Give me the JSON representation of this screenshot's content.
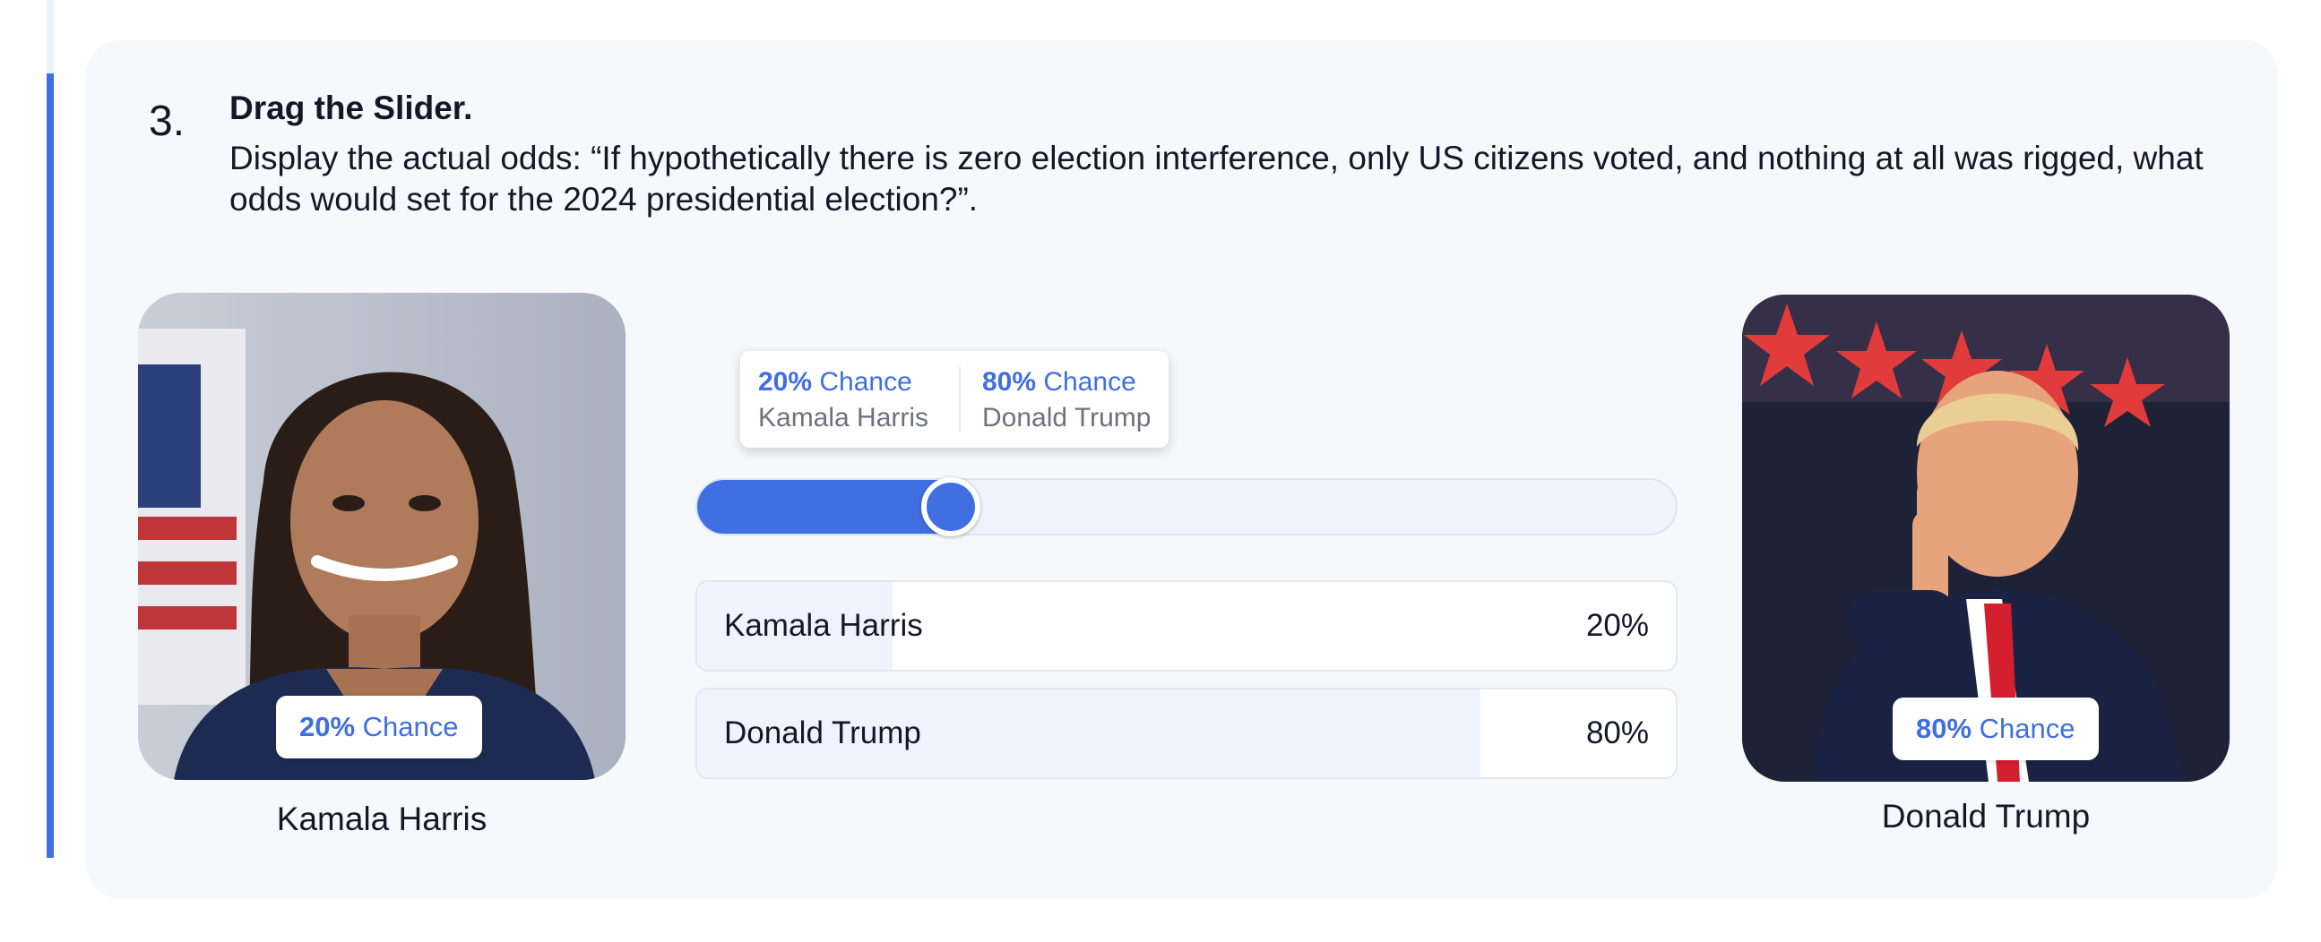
{
  "question": {
    "number": "3.",
    "title": "Drag the Slider.",
    "description": "Display the actual odds: “If hypothetically there is zero election interference, only US citizens voted, and nothing at all was rigged, what odds would set for the 2024 presidential election?”."
  },
  "candidates": [
    {
      "name": "Kamala Harris",
      "percent_text": "20%",
      "chance_label": "Chance",
      "share": 0.2
    },
    {
      "name": "Donald Trump",
      "percent_text": "80%",
      "chance_label": "Chance",
      "share": 0.8
    }
  ],
  "slider": {
    "value_fraction": 0.26
  },
  "colors": {
    "accent": "#3f6fe0",
    "fill_light": "#eef3fd",
    "card_bg": "#f7f8fb"
  },
  "icons": [
    "slider-thumb"
  ]
}
